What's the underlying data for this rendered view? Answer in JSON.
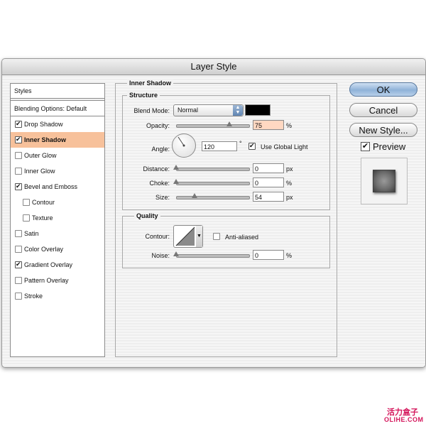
{
  "window": {
    "title": "Layer Style"
  },
  "styles_list": {
    "header": "Styles",
    "blending": "Blending Options: Default",
    "items": [
      {
        "label": "Drop Shadow",
        "checked": true,
        "indent": false,
        "selected": false
      },
      {
        "label": "Inner Shadow",
        "checked": true,
        "indent": false,
        "selected": true
      },
      {
        "label": "Outer Glow",
        "checked": false,
        "indent": false,
        "selected": false
      },
      {
        "label": "Inner Glow",
        "checked": false,
        "indent": false,
        "selected": false
      },
      {
        "label": "Bevel and Emboss",
        "checked": true,
        "indent": false,
        "selected": false
      },
      {
        "label": "Contour",
        "checked": false,
        "indent": true,
        "selected": false
      },
      {
        "label": "Texture",
        "checked": false,
        "indent": true,
        "selected": false
      },
      {
        "label": "Satin",
        "checked": false,
        "indent": false,
        "selected": false
      },
      {
        "label": "Color Overlay",
        "checked": false,
        "indent": false,
        "selected": false
      },
      {
        "label": "Gradient Overlay",
        "checked": true,
        "indent": false,
        "selected": false
      },
      {
        "label": "Pattern Overlay",
        "checked": false,
        "indent": false,
        "selected": false
      },
      {
        "label": "Stroke",
        "checked": false,
        "indent": false,
        "selected": false
      }
    ]
  },
  "inner_shadow": {
    "title": "Inner Shadow",
    "structure_title": "Structure",
    "blend_mode_label": "Blend Mode:",
    "blend_mode_value": "Normal",
    "shadow_color": "#000000",
    "opacity_label": "Opacity:",
    "opacity_value": "75",
    "opacity_unit": "%",
    "angle_label": "Angle:",
    "angle_value": "120",
    "angle_unit": "°",
    "use_global_light_label": "Use Global Light",
    "use_global_light": true,
    "distance_label": "Distance:",
    "distance_value": "0",
    "distance_unit": "px",
    "choke_label": "Choke:",
    "choke_value": "0",
    "choke_unit": "%",
    "size_label": "Size:",
    "size_value": "54",
    "size_unit": "px",
    "quality_title": "Quality",
    "contour_label": "Contour:",
    "anti_aliased_label": "Anti-aliased",
    "anti_aliased": false,
    "noise_label": "Noise:",
    "noise_value": "0",
    "noise_unit": "%"
  },
  "buttons": {
    "ok": "OK",
    "cancel": "Cancel",
    "new_style": "New Style..."
  },
  "preview": {
    "label": "Preview",
    "checked": true
  },
  "watermark": {
    "cn": "活力盒子",
    "en": "OLIHE.COM"
  },
  "colors": {
    "accent_selected": "#f7c19b",
    "default_button": "#8fb2d8",
    "watermark": "#d4145a"
  }
}
